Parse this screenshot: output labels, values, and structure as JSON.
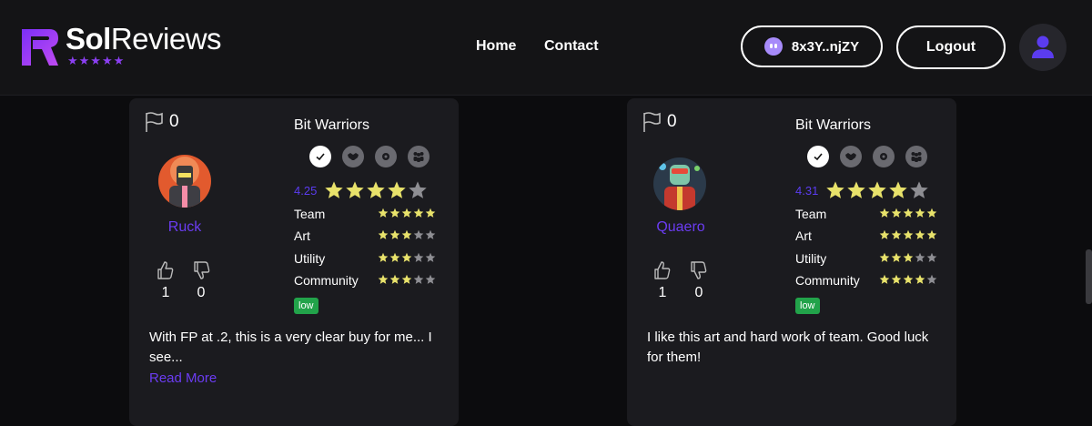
{
  "header": {
    "logo_text_bold": "Sol",
    "logo_text_regular": "Reviews",
    "logo_stars": "★★★★★",
    "nav": [
      "Home",
      "Contact"
    ],
    "wallet_label": "8x3Y..njZY",
    "logout_label": "Logout"
  },
  "colors": {
    "accent": "#6b3cf2",
    "star": "#e8e26b",
    "star_empty": "#8e8e93",
    "tag": "#22a34a"
  },
  "reviews": [
    {
      "flag_count": "0",
      "username": "Ruck",
      "upvotes": "1",
      "downvotes": "0",
      "collection": "Bit Warriors",
      "overall_score": "4.25",
      "overall_rating": 4.25,
      "categories": [
        {
          "label": "Team",
          "rating": 5
        },
        {
          "label": "Art",
          "rating": 3
        },
        {
          "label": "Utility",
          "rating": 3
        },
        {
          "label": "Community",
          "rating": 3
        }
      ],
      "tag": "low",
      "text": "With FP at .2, this is a very clear buy for me... I see...",
      "read_more": "Read More"
    },
    {
      "flag_count": "0",
      "username": "Quaero",
      "upvotes": "1",
      "downvotes": "0",
      "collection": "Bit Warriors",
      "overall_score": "4.31",
      "overall_rating": 4.31,
      "categories": [
        {
          "label": "Team",
          "rating": 5
        },
        {
          "label": "Art",
          "rating": 5
        },
        {
          "label": "Utility",
          "rating": 3
        },
        {
          "label": "Community",
          "rating": 4
        }
      ],
      "tag": "low",
      "text": "I like this art and hard work of team. Good luck for them!",
      "read_more": ""
    }
  ],
  "badge_icons": [
    "check-icon",
    "handshake-icon",
    "gear-icon",
    "community-icon"
  ]
}
